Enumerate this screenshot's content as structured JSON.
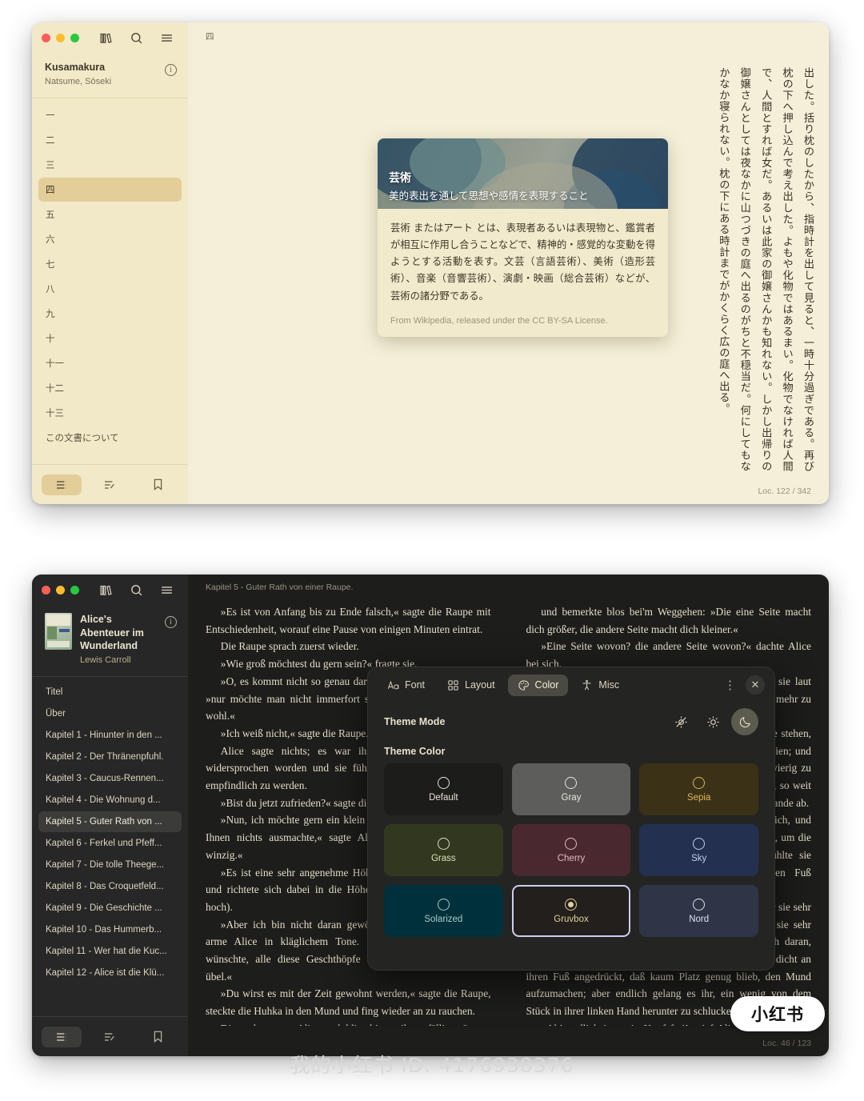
{
  "window_light": {
    "traffic_lights": [
      "close",
      "minimize",
      "maximize"
    ],
    "toolbar": {
      "library_label": "library-icon",
      "search_label": "search-icon",
      "menu_label": "menu-icon",
      "pin_label": "pin-icon"
    },
    "book": {
      "title": "Kusamakura",
      "author": "Natsume, Sōseki",
      "info_glyph": "i"
    },
    "toc": [
      {
        "label": "一",
        "selected": false
      },
      {
        "label": "二",
        "selected": false
      },
      {
        "label": "三",
        "selected": false
      },
      {
        "label": "四",
        "selected": true
      },
      {
        "label": "五",
        "selected": false
      },
      {
        "label": "六",
        "selected": false
      },
      {
        "label": "七",
        "selected": false
      },
      {
        "label": "八",
        "selected": false
      },
      {
        "label": "九",
        "selected": false
      },
      {
        "label": "十",
        "selected": false
      },
      {
        "label": "十一",
        "selected": false
      },
      {
        "label": "十二",
        "selected": false
      },
      {
        "label": "十三",
        "selected": false
      },
      {
        "label": "この文書について",
        "selected": false
      }
    ],
    "bottom_tabs": [
      {
        "name": "contents",
        "selected": true
      },
      {
        "name": "annotations",
        "selected": false
      },
      {
        "name": "bookmarks",
        "selected": false
      }
    ],
    "chapter_mark": "四",
    "status": "Loc. 122 / 342",
    "body_text": "出した。括り枕のしたから、指時計を出して見ると、一時十分過ぎである。再び枕の下へ押し込んで考え出した。よもや化物ではあるまい。化物でなければ人間で、人間とすれば女だ。あるいは此家の御嬢さんかも知れない。しかし出帰りの御嬢さんとしては夜なかに山つづきの庭へ出るのがちと不穏当だ。何にしてもなかなか寝られない。枕の下にある時計までがかくらく広の庭へ出る。",
    "wiki_card": {
      "title": "芸術",
      "subtitle": "美的表出を通して思想や感情を表現すること",
      "body_lead": "芸術",
      "body_bold2": "アート",
      "body": "芸術 またはアート とは、表現者あるいは表現物と、鑑賞者が相互に作用し合うことなどで、精神的・感覚的な変動を得ようとする活動を表す。文芸（言語芸術）、美術（造形芸術）、音楽（音響芸術）、演劇・映画（総合芸術）などが、芸術の諸分野である。",
      "credit": "From Wikipedia, released under the CC BY-SA License."
    }
  },
  "window_dark": {
    "toolbar": {
      "library_label": "library-icon",
      "search_label": "search-icon",
      "menu_label": "menu-icon",
      "pin_label": "pin-icon"
    },
    "book": {
      "title": "Alice's Abenteuer im Wunderland",
      "author": "Lewis Carroll",
      "info_glyph": "i",
      "cover_alt": "alice-book-cover"
    },
    "toc": [
      {
        "label": "Titel",
        "selected": false
      },
      {
        "label": "Über",
        "selected": false
      },
      {
        "label": "Kapitel 1 - Hinunter in den ...",
        "selected": false
      },
      {
        "label": "Kapitel 2 - Der Thränenpfuhl.",
        "selected": false
      },
      {
        "label": "Kapitel 3 - Caucus-Rennen...",
        "selected": false
      },
      {
        "label": "Kapitel 4 - Die Wohnung d...",
        "selected": false
      },
      {
        "label": "Kapitel 5 - Guter Rath von ...",
        "selected": true
      },
      {
        "label": "Kapitel 6 - Ferkel und Pfeff...",
        "selected": false
      },
      {
        "label": "Kapitel 7 - Die tolle Theege...",
        "selected": false
      },
      {
        "label": "Kapitel 8 - Das Croquetfeld...",
        "selected": false
      },
      {
        "label": "Kapitel 9 - Die Geschichte ...",
        "selected": false
      },
      {
        "label": "Kapitel 10 - Das Hummerb...",
        "selected": false
      },
      {
        "label": "Kapitel 11 - Wer hat die Kuc...",
        "selected": false
      },
      {
        "label": "Kapitel 12 - Alice ist die Klü...",
        "selected": false
      }
    ],
    "bottom_tabs": [
      {
        "name": "contents",
        "selected": true
      },
      {
        "name": "annotations",
        "selected": false
      },
      {
        "name": "bookmarks",
        "selected": false
      }
    ],
    "breadcrumb": "Kapitel 5 - Guter Rath von einer Raupe.",
    "status": "Loc. 46 / 123",
    "paragraphs_left": [
      "»Es ist von Anfang bis zu Ende falsch,« sagte die Raupe mit Entschiedenheit, worauf eine Pause von einigen Minuten eintrat.",
      "Die Raupe sprach zuerst wieder.",
      "»Wie groß möchtest du gern sein?« fragte sie.",
      "»O, es kommt nicht so genau darauf an,« sagte Alice schnell; »nur möchte man nicht immerfort sich ändern, das wissen Sie wohl.«",
      "»Ich weiß nicht,« sagte die Raupe.",
      "Alice sagte nichts; es war ihr noch nie im Leben so widersprochen worden und sie fühlte, daß sie wieder anfing, empfindlich zu werden.",
      "»Bist du jetzt zufrieden?« sagte die Raupe.",
      "»Nun, ich möchte gern ein klein wenig größer sein, wenn es Ihnen nichts ausmachte,« sagte Alice; »drei Zoll ist gar zu winzig.«",
      "»Es ist eine sehr angenehme Höhe,« sagte die Raupe zornig und richtete sich dabei in die Höhe (sie war gerade drei Zoll hoch).",
      "»Aber ich bin nicht daran gewöhnt!« vertheidigte sich die arme Alice in kläglichem Tone. Bei sich dachte sie: »Ich wünschte, alle diese Geschthöpfe nähmen nicht Alles gleich übel.«",
      "»Du wirst es mit der Zeit gewohnt werden,« sagte die Raupe, steckte die Huhka in den Mund und fing wieder an zu rauchen.",
      "Diesmal wartete Alice geduldig, bis es ihr gefällig wäre zu reden. Nach zwei oder drei Minuten nahm die Raupe die Huhka aus dem Munde, gähnte ein bis zwei Mal und schüttelte sich. Dann kam sie von dem Pilze herunter, kroch in's Gras hinein"
    ],
    "paragraphs_right": [
      "und bemerkte blos bei'm Weggehen: »Die eine Seite macht dich größer, die andere Seite macht dich kleiner.«",
      "»Eine Seite wovon? die andere Seite wovon?« dachte Alice bei sich.",
      "»Von dem Pilz,« sagte die Raupe, gerade als wenn sie laut gefragt hätte; und den nächsten Augenblick war sie nicht mehr zu sehen.",
      "Alice blieb ein Weilchen gedankenvoll vor dem Pilze stehen, um ausfindig zu machen, welches seine beiden Seiten seien; und da er vollkommen rund war, so fand sie die Frage schwierig zu beantworten. Doch endlich reichte sie mit beiden Armen, so weit sie herum konnte, und brach mit jeder Hand etwas vom Rande ab.",
      "»Und welches ist nun das rechte?« sprach sie zu sich, und knabberte ein wenig vom Stück in ihrer rechten Hand ab, um die Wirkung auszuprobieren; den nächsten Augenblick fühlte sie einen heftigen Schlag am Kinn, es hatte an ihren Fuß angesählagen!",
      "Sie war sehr erschrocken über diese Verwandlung war sie sehr erschrocken, fürchtete aber keine Zeit zu verlieren, da sie sehr schnell kleiner wurde; daher machte sie sich so gleich daran, etwas von dem andern Stück zu essen. Ihr Kinn war so dicht an ihren Fuß angedrückt, daß kaum Platz genug blieb, den Mund aufzumachen; aber endlich gelang es ihr, ein wenig von dem Stück in ihrer linken Hand herunter zu schlucken.",
      "»Ah! endlich ist mein Kopf frei!« rief Alice mit Entzücken, das sich jedoch den nächsten Augenblick in Angst verwandelte, da sie merkte, daß ihre Schultern nirgends zu finden waren."
    ]
  },
  "settings_popover": {
    "tabs": [
      {
        "label": "Font",
        "icon": "font-icon",
        "selected": false
      },
      {
        "label": "Layout",
        "icon": "layout-icon",
        "selected": false
      },
      {
        "label": "Color",
        "icon": "palette-icon",
        "selected": true
      },
      {
        "label": "Misc",
        "icon": "accessibility-icon",
        "selected": false
      }
    ],
    "kebab_label": "⋮",
    "close_label": "✕",
    "theme_mode": {
      "label": "Theme Mode",
      "options": [
        {
          "name": "auto",
          "icon": "auto-theme-icon",
          "selected": false
        },
        {
          "name": "light",
          "icon": "sun-icon",
          "selected": false
        },
        {
          "name": "dark",
          "icon": "moon-icon",
          "selected": true
        }
      ]
    },
    "theme_color": {
      "label": "Theme Color",
      "options": [
        {
          "label": "Default",
          "bg": "#1c1c1a",
          "fg": "#e8e2d0",
          "selected": false
        },
        {
          "label": "Gray",
          "bg": "#5d5d5b",
          "fg": "#e9e6de",
          "selected": false
        },
        {
          "label": "Sepia",
          "bg": "#3a3117",
          "fg": "#e0b55b",
          "selected": false
        },
        {
          "label": "Grass",
          "bg": "#32381f",
          "fg": "#d6e0b4",
          "selected": false
        },
        {
          "label": "Cherry",
          "bg": "#4a2830",
          "fg": "#e6b9c4",
          "selected": false
        },
        {
          "label": "Sky",
          "bg": "#24304f",
          "fg": "#c3cfee",
          "selected": false
        },
        {
          "label": "Solarized",
          "bg": "#00303b",
          "fg": "#a6cbcb",
          "selected": false
        },
        {
          "label": "Gruvbox",
          "bg": "#221f1c",
          "fg": "#e4cf9a",
          "selected": true
        },
        {
          "label": "Nord",
          "bg": "#2f3546",
          "fg": "#dfe3ee",
          "selected": false
        }
      ]
    }
  },
  "watermark": {
    "badge": "小红书",
    "caption": "我的小红书 ID: 4176938376"
  }
}
